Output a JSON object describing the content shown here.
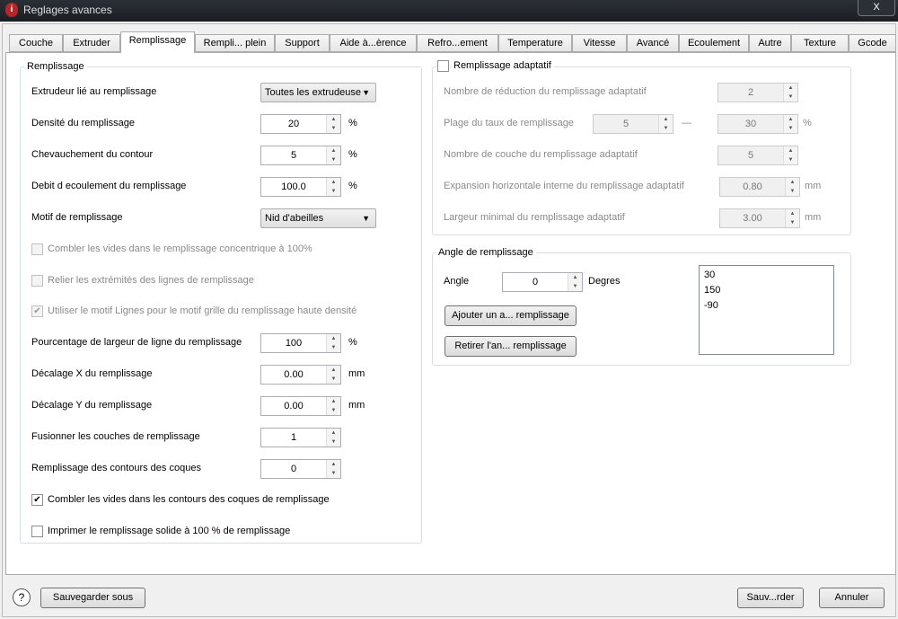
{
  "window": {
    "title": "Reglages avances",
    "close": "X",
    "app_icon": "i"
  },
  "tabs": [
    "Couche",
    "Extruder",
    "Remplissage",
    "Rempli... plein",
    "Support",
    "Aide à...èrence",
    "Refro...ement",
    "Temperature",
    "Vitesse",
    "Avancé",
    "Ecoulement",
    "Autre",
    "Texture",
    "Gcode"
  ],
  "active_tab": "Remplissage",
  "left": {
    "group_title": "Remplissage",
    "extruder": {
      "label": "Extrudeur lié au remplissage",
      "value": "Toutes les extrudeuse"
    },
    "density": {
      "label": "Densité du remplissage",
      "value": "20",
      "unit": "%"
    },
    "overlap": {
      "label": "Chevauchement du contour",
      "value": "5",
      "unit": "%"
    },
    "flow": {
      "label": "Debit d ecoulement du remplissage",
      "value": "100.0",
      "unit": "%"
    },
    "pattern": {
      "label": "Motif de remplissage",
      "value": "Nid d'abeilles"
    },
    "cb_concentric": {
      "label": "Combler les vides dans le remplissage concentrique à 100%",
      "checked": false,
      "disabled": true
    },
    "cb_connect": {
      "label": "Relier les extrémités des lignes de remplissage",
      "checked": false,
      "disabled": true
    },
    "cb_lines": {
      "label": "Utiliser le motif Lignes pour le motif grille du remplissage haute densité",
      "checked": true,
      "disabled": true
    },
    "linewidth": {
      "label": "Pourcentage de largeur de ligne du remplissage",
      "value": "100",
      "unit": "%"
    },
    "offset_x": {
      "label": "Décalage X du remplissage",
      "value": "0.00",
      "unit": "mm"
    },
    "offset_y": {
      "label": "Décalage Y du remplissage",
      "value": "0.00",
      "unit": "mm"
    },
    "merge": {
      "label": "Fusionner les couches de remplissage",
      "value": "1"
    },
    "shell_fill": {
      "label": "Remplissage des contours des coques",
      "value": "0"
    },
    "cb_gaps": {
      "label": "Combler les vides dans les contours des coques de remplissage",
      "checked": true
    },
    "cb_solid": {
      "label": "Imprimer le remplissage solide à 100 % de remplissage",
      "checked": false
    }
  },
  "adaptive": {
    "title": "Remplissage adaptatif",
    "checked": false,
    "reduction": {
      "label": "Nombre de réduction du remplissage adaptatif",
      "value": "2"
    },
    "range": {
      "label": "Plage du taux de remplissage",
      "min": "5",
      "sep": "—",
      "max": "30",
      "unit": "%"
    },
    "layers": {
      "label": "Nombre de couche du remplissage adaptatif",
      "value": "5"
    },
    "expansion": {
      "label": "Expansion horizontale interne du remplissage adaptatif",
      "value": "0.80",
      "unit": "mm"
    },
    "minwidth": {
      "label": "Largeur minimal du remplissage adaptatif",
      "value": "3.00",
      "unit": "mm"
    }
  },
  "angles": {
    "title": "Angle de remplissage",
    "label": "Angle",
    "value": "0",
    "unit": "Degres",
    "add": "Ajouter un a... remplissage",
    "remove": "Retirer l'an... remplissage",
    "list": [
      "30",
      "150",
      "-90"
    ]
  },
  "footer": {
    "help": "?",
    "save_as": "Sauvegarder sous",
    "save": "Sauv...rder",
    "cancel": "Annuler"
  }
}
